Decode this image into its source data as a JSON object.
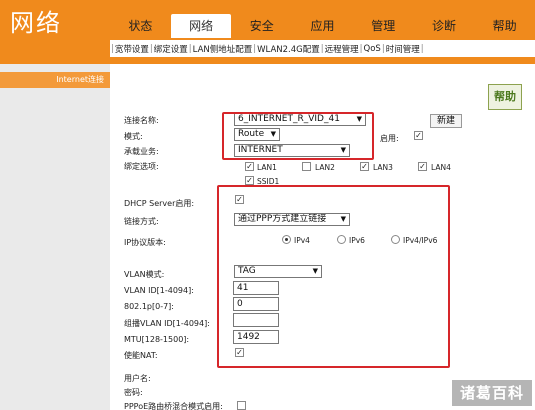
{
  "header": {
    "logo": "网络"
  },
  "topnav": [
    "状态",
    "网络",
    "安全",
    "应用",
    "管理",
    "诊断",
    "帮助"
  ],
  "subnav": [
    "宽带设置",
    "绑定设置",
    "LAN侧地址配置",
    "WLAN2.4G配置",
    "远程管理",
    "QoS",
    "时间管理"
  ],
  "sidebar": {
    "item": "Internet连接"
  },
  "help": "帮助",
  "form": {
    "conn_name_label": "连接名称:",
    "conn_name_value": "6_INTERNET_R_VID_41",
    "new_button": "新建",
    "mode_label": "模式:",
    "mode_value": "Route",
    "enable_label": "启用:",
    "service_label": "承载业务:",
    "service_value": "INTERNET",
    "bind_label": "绑定选项:",
    "bind_options": [
      "LAN1",
      "LAN2",
      "LAN3",
      "LAN4",
      "SSID1"
    ],
    "dhcp_label": "DHCP Server启用:",
    "link_label": "链接方式:",
    "link_value": "通过PPP方式建立链接",
    "ip_label": "IP协议版本:",
    "ip_options": [
      "IPv4",
      "IPv6",
      "IPv4/IPv6"
    ],
    "vlan_mode_label": "VLAN模式:",
    "vlan_mode_value": "TAG",
    "vlan_id_label": "VLAN ID[1-4094]:",
    "vlan_id_value": "41",
    "dot1p_label": "802.1p[0-7]:",
    "dot1p_value": "0",
    "mvlan_label": "组播VLAN ID[1-4094]:",
    "mvlan_value": "",
    "mtu_label": "MTU[128-1500]:",
    "mtu_value": "1492",
    "nat_label": "使能NAT:",
    "user_label": "用户名:",
    "pass_label": "密码:",
    "pppoe_label": "PPPoE路由桥混合模式启用:"
  },
  "watermark": "诸葛百科",
  "colors": {
    "header": "#f08a1c",
    "sidebar": "#eaeaea",
    "highlight": "#d6262a",
    "help_text": "#4d7a1f"
  }
}
